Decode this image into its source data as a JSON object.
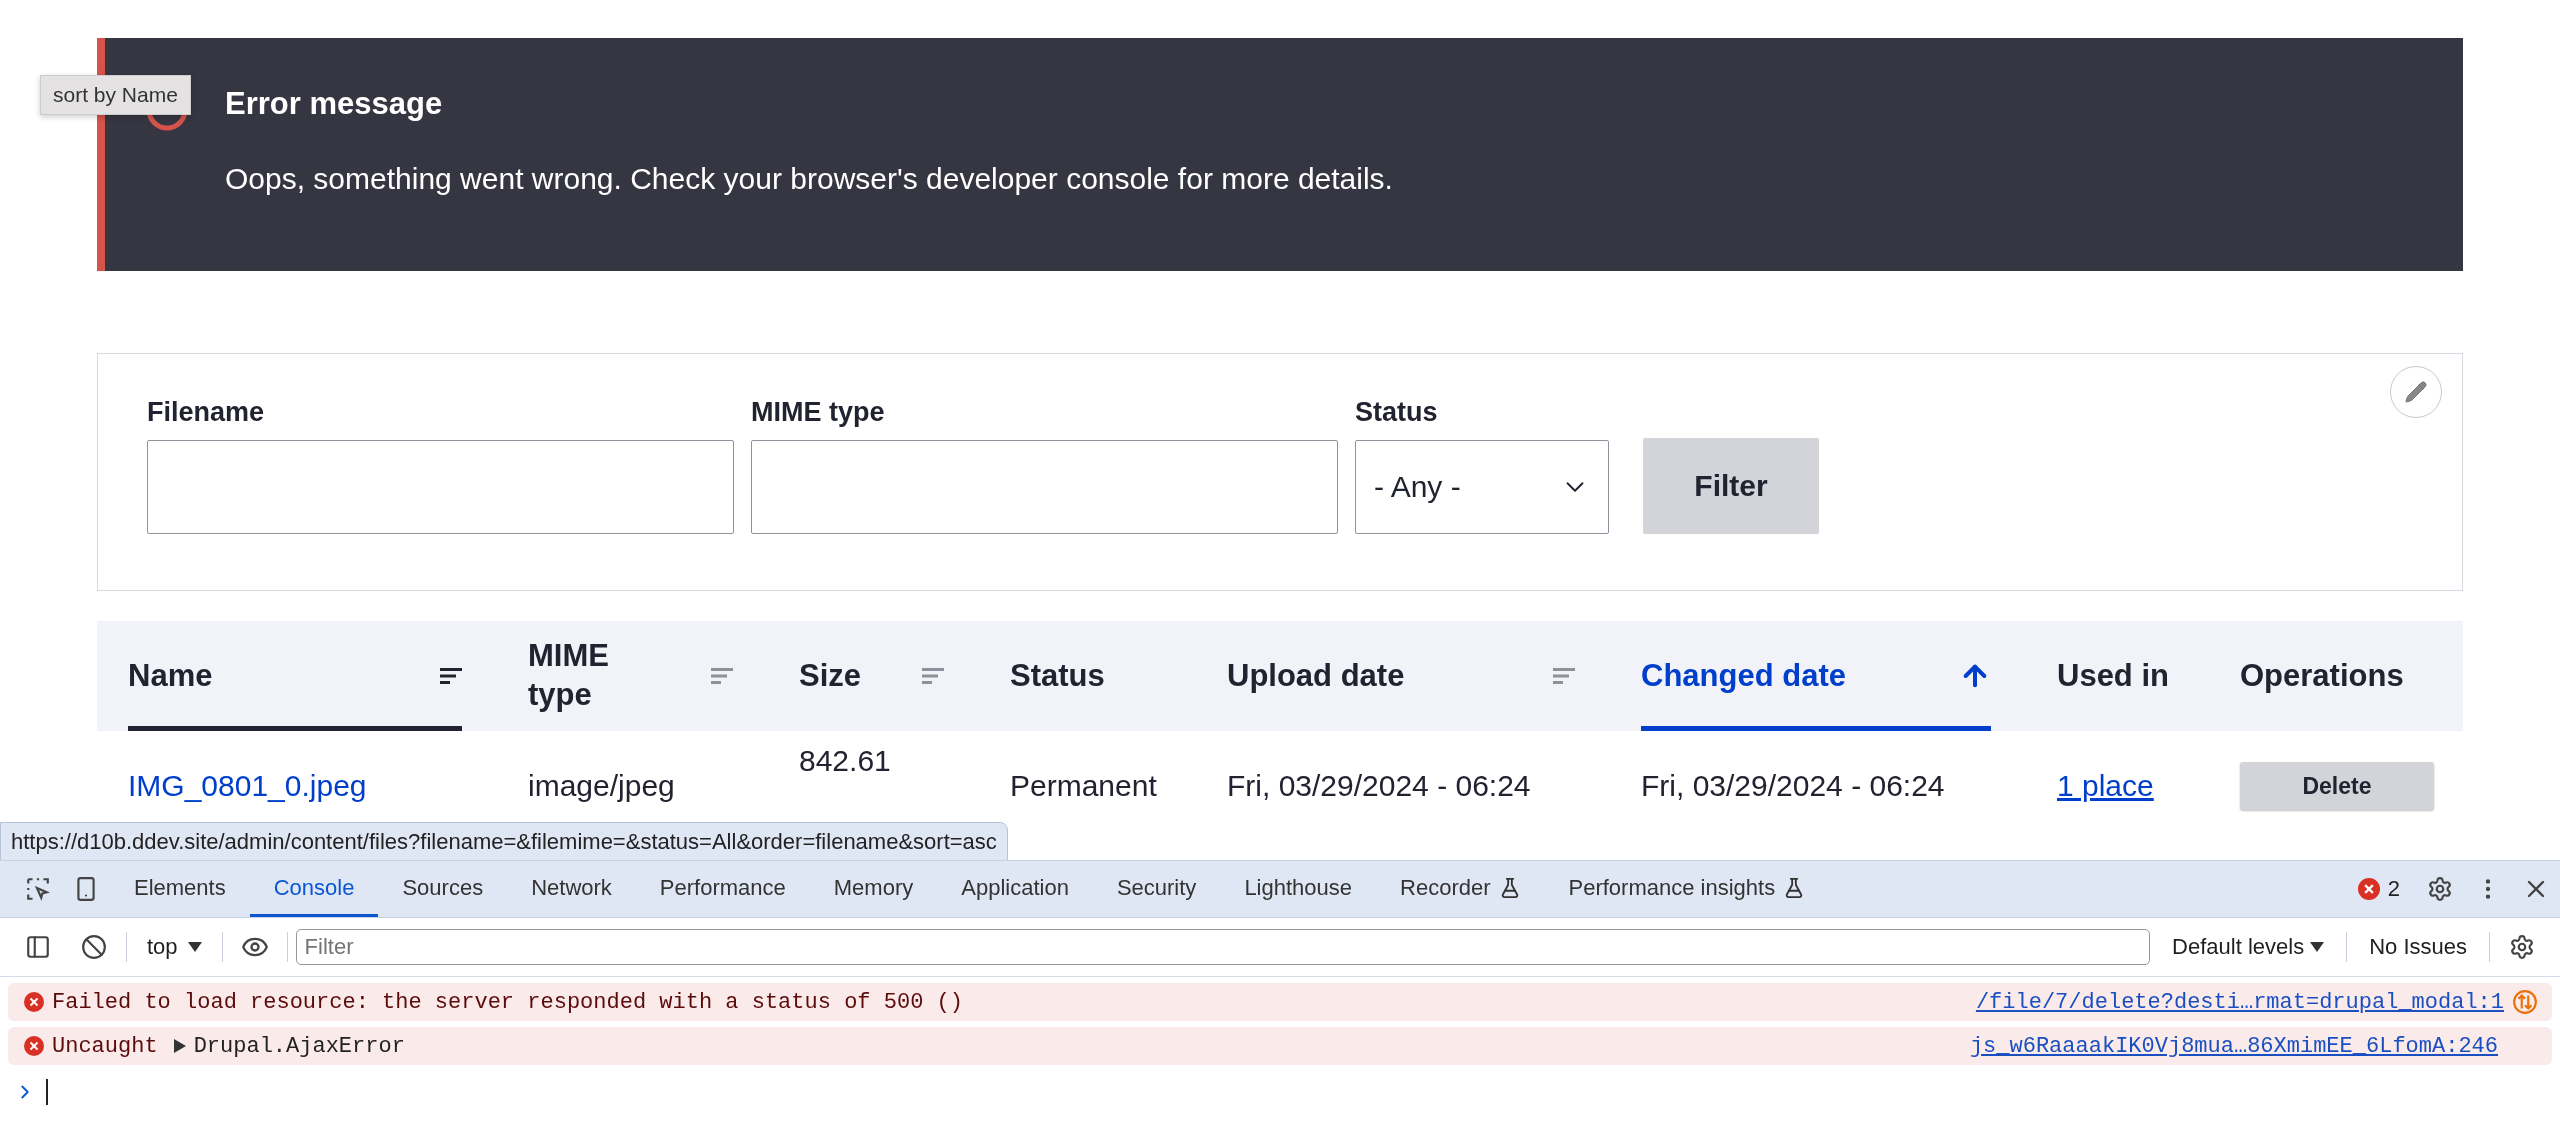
{
  "tooltip": {
    "text": "sort by Name"
  },
  "error": {
    "title": "Error message",
    "message": "Oops, something went wrong. Check your browser's developer console for more details."
  },
  "filters": {
    "fields": [
      {
        "kind": "text",
        "label": "Filename"
      },
      {
        "kind": "text",
        "label": "MIME type"
      },
      {
        "kind": "select",
        "label": "Status",
        "value": "- Any -"
      }
    ],
    "button": "Filter"
  },
  "table": {
    "columns": [
      {
        "label": "Name",
        "sortable": true,
        "hovered": true,
        "selected": false
      },
      {
        "label": "MIME type",
        "sortable": true,
        "hovered": false,
        "selected": false
      },
      {
        "label": "Size",
        "sortable": true,
        "hovered": false,
        "selected": false
      },
      {
        "label": "Status",
        "sortable": false,
        "hovered": false,
        "selected": false
      },
      {
        "label": "Upload date",
        "sortable": true,
        "hovered": false,
        "selected": false
      },
      {
        "label": "Changed date",
        "sortable": true,
        "hovered": false,
        "selected": true
      },
      {
        "label": "Used in",
        "sortable": false,
        "hovered": false,
        "selected": false
      },
      {
        "label": "Operations",
        "sortable": false,
        "hovered": false,
        "selected": false
      }
    ],
    "rows": [
      {
        "cells": [
          {
            "kind": "link",
            "text": "IMG_0801_0.jpeg"
          },
          {
            "kind": "text",
            "text": "image/jpeg"
          },
          {
            "kind": "size",
            "text": "842.61"
          },
          {
            "kind": "text",
            "text": "Permanent"
          },
          {
            "kind": "text",
            "text": "Fri, 03/29/2024 - 06:24"
          },
          {
            "kind": "text",
            "text": "Fri, 03/29/2024 - 06:24"
          },
          {
            "kind": "underlined_link",
            "text": "1 place"
          },
          {
            "kind": "button",
            "text": "Delete"
          }
        ]
      }
    ]
  },
  "status_url": "https://d10b.ddev.site/admin/content/files?filename=&filemime=&status=All&order=filename&sort=asc",
  "devtools": {
    "tabs": [
      {
        "label": "Elements",
        "selected": false,
        "experimental": false
      },
      {
        "label": "Console",
        "selected": true,
        "experimental": false
      },
      {
        "label": "Sources",
        "selected": false,
        "experimental": false
      },
      {
        "label": "Network",
        "selected": false,
        "experimental": false
      },
      {
        "label": "Performance",
        "selected": false,
        "experimental": false
      },
      {
        "label": "Memory",
        "selected": false,
        "experimental": false
      },
      {
        "label": "Application",
        "selected": false,
        "experimental": false
      },
      {
        "label": "Security",
        "selected": false,
        "experimental": false
      },
      {
        "label": "Lighthouse",
        "selected": false,
        "experimental": false
      },
      {
        "label": "Recorder",
        "selected": false,
        "experimental": true
      },
      {
        "label": "Performance insights",
        "selected": false,
        "experimental": true
      }
    ],
    "error_count": "2",
    "context": "top",
    "filter_placeholder": "Filter",
    "levels": "Default levels",
    "issues": "No Issues",
    "messages": [
      {
        "text": "Failed to load resource: the server responded with a status of 500 ()",
        "expandable": false,
        "source": "/file/7/delete?desti…rmat=drupal_modal:1",
        "network_icon": true
      },
      {
        "label": "Uncaught",
        "text": "Drupal.AjaxError",
        "expandable": true,
        "source": "js_w6RaaaakIK0Vj8mua…86XmimEE_6LfomA:246",
        "network_icon": false
      }
    ]
  }
}
